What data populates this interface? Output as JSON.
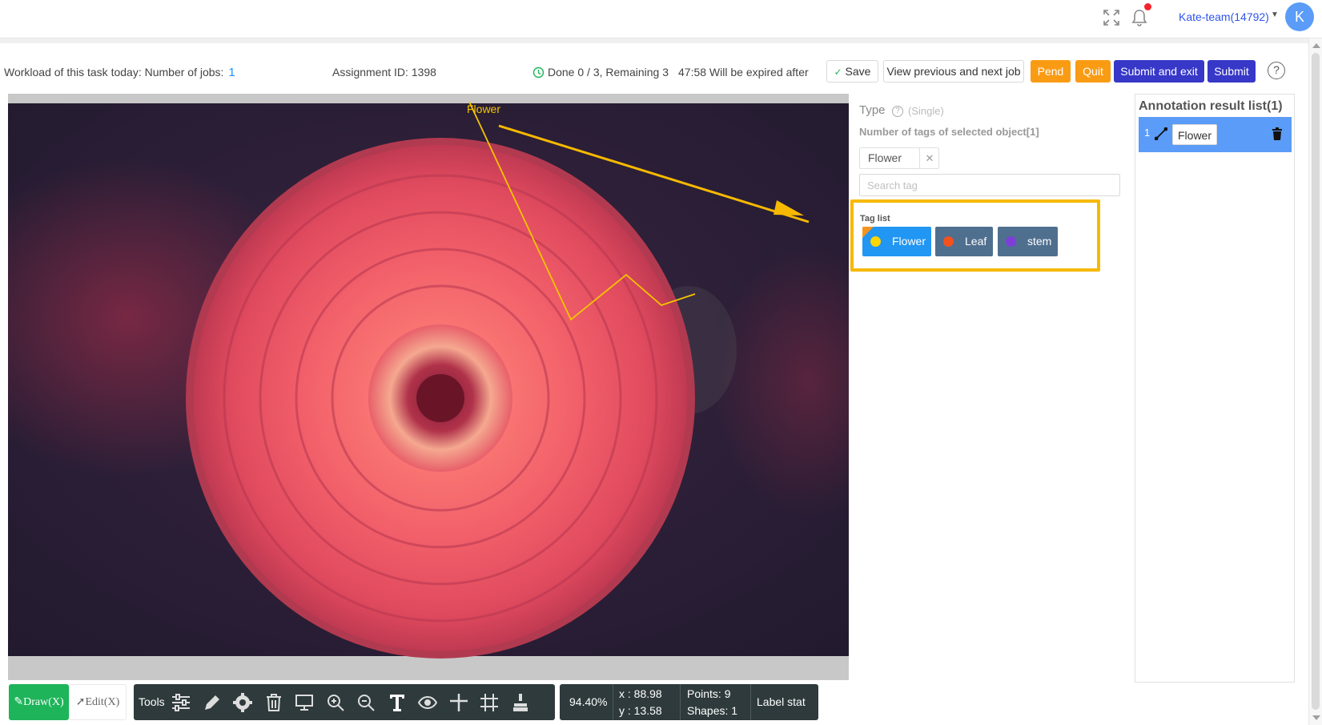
{
  "header": {
    "user_name": "Kate-team(14792)",
    "avatar_letter": "K",
    "icons": [
      "expand-icon",
      "bell-icon",
      "chevron-down-icon"
    ]
  },
  "task_info": {
    "workload_label": "Workload of this task today: Number of jobs:",
    "jobs_count": "1",
    "assignment": "Assignment ID: 1398",
    "progress": "Done 0 / 3, Remaining 3",
    "timer": "47:58 Will be expired after"
  },
  "actions": {
    "save": "Save",
    "view_prev_next": "View previous and next job",
    "pend": "Pend",
    "quit": "Quit",
    "submit_exit": "Submit and exit",
    "submit": "Submit",
    "help": "?"
  },
  "canvas": {
    "annotation_label": "Flower",
    "annotation_color": "#f5c400"
  },
  "toolbar": {
    "draw": "Draw(X)",
    "edit": "Edit(X)",
    "tools_label": "Tools",
    "tool_icons": [
      "sliders-icon",
      "pencil-icon",
      "gear-icon",
      "trash-icon",
      "monitor-icon",
      "zoom-in-icon",
      "zoom-out-icon",
      "text-icon",
      "eye-icon",
      "crosshair-icon",
      "grid-icon",
      "brush-icon"
    ]
  },
  "stats": {
    "zoom": "94.40%",
    "x": "x : 88.98",
    "y": "y : 13.58",
    "points": "Points:  9",
    "shapes": "Shapes:  1",
    "label_stat": "Label stat"
  },
  "type_panel": {
    "type_label": "Type",
    "type_mode": "(Single)",
    "num_tags": "Number of tags of selected object[1]",
    "selected_tag": "Flower",
    "search_placeholder": "Search tag",
    "tag_list_label": "Tag list",
    "tags": [
      {
        "label": "Flower",
        "bg": "#2196f3",
        "dot": "#ffd600",
        "selected": true
      },
      {
        "label": "Leaf",
        "bg": "#4f6f8f",
        "dot": "#f4511e",
        "selected": false
      },
      {
        "label": "stem",
        "bg": "#4f6f8f",
        "dot": "#7e3fd9",
        "selected": false
      }
    ]
  },
  "results": {
    "title": "Annotation result list(1)",
    "items": [
      {
        "index": "1",
        "label": "Flower"
      }
    ]
  },
  "colors": {
    "accent_blue": "#3737c8",
    "orange": "#fa9b14",
    "green": "#1eb45a",
    "highlight_yellow": "#f6b900"
  }
}
